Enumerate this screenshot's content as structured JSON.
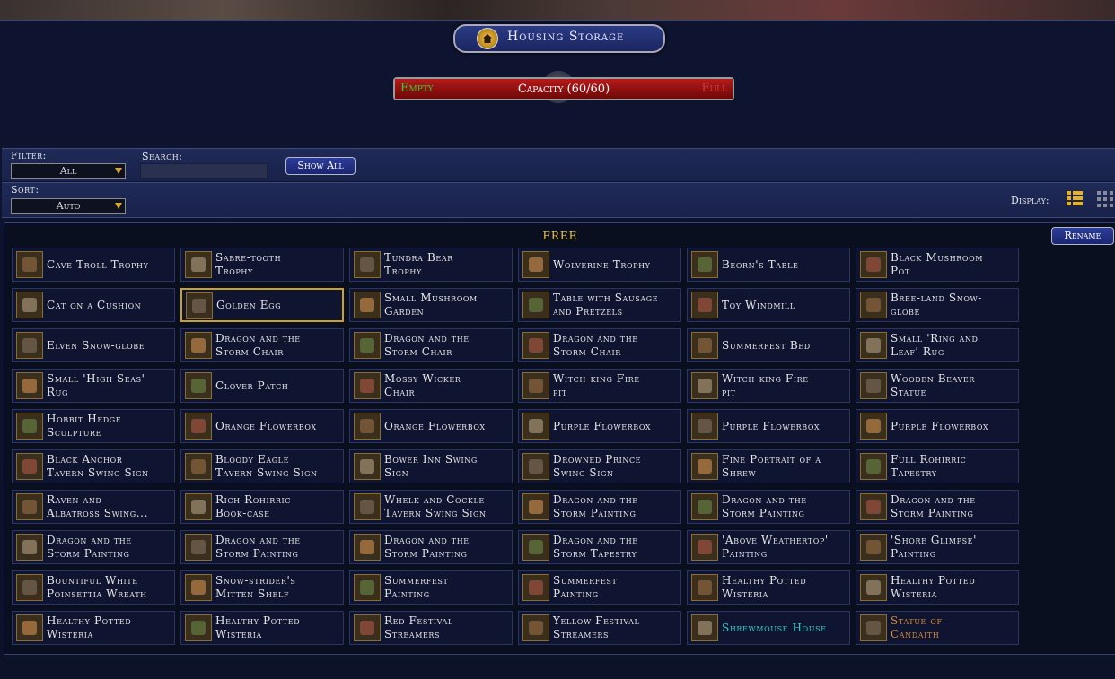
{
  "window": {
    "title": "Housing Storage"
  },
  "capacity": {
    "empty_label": "Empty",
    "full_label": "Full",
    "label": "Capacity (60/60)",
    "used": 60,
    "max": 60,
    "bar_color": "#a01515"
  },
  "filter": {
    "label": "Filter:",
    "value": "All"
  },
  "search": {
    "label": "Search:",
    "value": ""
  },
  "show_all": "Show All",
  "sort": {
    "label": "Sort:",
    "value": "Auto"
  },
  "display": {
    "label": "Display:",
    "modes": [
      "list-view-icon",
      "grid-view-icon"
    ],
    "active": "list-view-icon"
  },
  "group": {
    "name": "FREE",
    "rename_label": "Rename"
  },
  "accent": "#c9a227",
  "items": [
    [
      "Cave Troll Trophy",
      "Sabre-tooth\nTrophy",
      "Tundra Bear\nTrophy",
      "Wolverine Trophy",
      "Beorn's Table",
      "Black Mushroom\nPot"
    ],
    [
      "Cat on a Cushion",
      "Golden Egg",
      "Small Mushroom\nGarden",
      "Table with Sausage\nand Pretzels",
      "Toy Windmill",
      "Bree-land Snow-\nglobe"
    ],
    [
      "Elven Snow-globe",
      "Dragon and the\nStorm Chair",
      "Dragon and the\nStorm Chair",
      "Dragon and the\nStorm Chair",
      "Summerfest Bed",
      "Small 'Ring and\nLeaf' Rug"
    ],
    [
      "Small 'High Seas'\nRug",
      "Clover Patch",
      "Mossy Wicker\nChair",
      "Witch-king Fire-\npit",
      "Witch-king Fire-\npit",
      "Wooden Beaver\nStatue"
    ],
    [
      "Hobbit Hedge\nSculpture",
      "Orange Flowerbox",
      "Orange Flowerbox",
      "Purple Flowerbox",
      "Purple Flowerbox",
      "Purple Flowerbox"
    ],
    [
      "Black Anchor\nTavern Swing Sign",
      "Bloody Eagle\nTavern Swing Sign",
      "Bower Inn Swing\nSign",
      "Drowned Prince\nSwing Sign",
      "Fine Portrait of a\nShrew",
      "Full Rohirric\nTapestry"
    ],
    [
      "Raven and\nAlbatross Swing...",
      "Rich Rohirric\nBook-case",
      "Whelk and Cockle\nTavern Swing Sign",
      "Dragon and the\nStorm Painting",
      "Dragon and the\nStorm Painting",
      "Dragon and the\nStorm Painting"
    ],
    [
      "Dragon and the\nStorm Painting",
      "Dragon and the\nStorm Painting",
      "Dragon and the\nStorm Painting",
      "Dragon and the\nStorm Tapestry",
      "'Above Weathertop'\nPainting",
      "'Shore Glimpse'\nPainting"
    ],
    [
      "Bountiful White\nPoinsettia Wreath",
      "Snow-strider's\nMitten Shelf",
      "Summerfest\nPainting",
      "Summerfest\nPainting",
      "Healthy Potted\nWisteria",
      "Healthy Potted\nWisteria"
    ],
    [
      "Healthy Potted\nWisteria",
      "Healthy Potted\nWisteria",
      "Red Festival\nStreamers",
      "Yellow Festival\nStreamers",
      "Shrewmouse House",
      "Statue of\nCandaith"
    ]
  ],
  "selected_item": "Golden Egg",
  "special_colors": {
    "Shrewmouse House": "#34c8c8",
    "Statue of\nCandaith": "#d98a2c"
  },
  "icon_colors": [
    "#7a5a3a",
    "#8a7a60",
    "#6a5a4a",
    "#a07040",
    "#5a6a3a",
    "#8a4a3a"
  ]
}
